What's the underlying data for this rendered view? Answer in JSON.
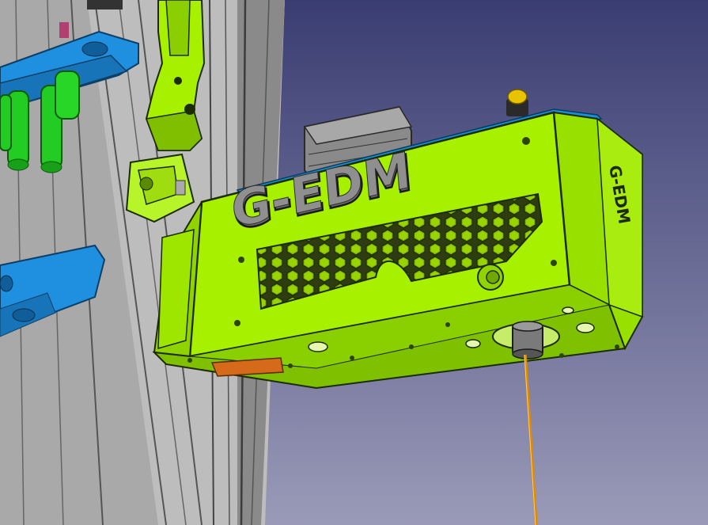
{
  "viewport": {
    "background_top": "#3a3d72",
    "background_bottom": "#9a9ab8"
  },
  "colors": {
    "housing_green": "#a6f000",
    "housing_green_dark": "#6fa800",
    "housing_green_shadow": "#4f7a00",
    "extrusion_gray": "#b8b8b8",
    "extrusion_dark": "#6a6a6a",
    "bracket_blue": "#1f8fe0",
    "spacer_green": "#22cc22",
    "wire_orange": "#e08a00",
    "motor_gray": "#8a8a8a",
    "button_yellow": "#e8c400",
    "blue_strip": "#1a8fd8"
  },
  "part": {
    "logo_text": "G-EDM",
    "side_engraving": "G-EDM",
    "honeycomb_cut": "hexagon-vent"
  },
  "icons": {
    "model": "cad-3d-model-icon",
    "wire": "electrode-wire-icon"
  }
}
